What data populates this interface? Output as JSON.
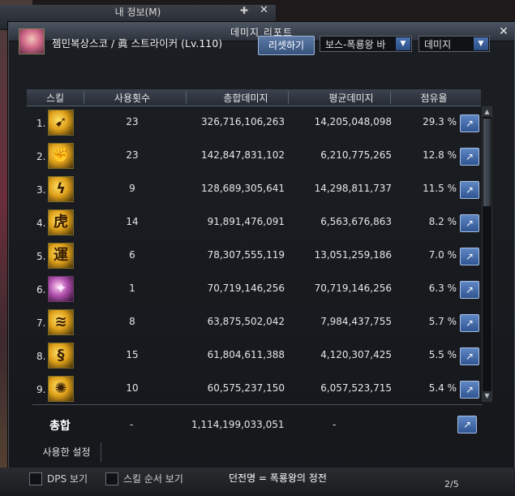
{
  "back_window": {
    "title": "내 정보(M)",
    "pin_icon": "pin-icon",
    "close_icon": "close-icon"
  },
  "window": {
    "title": "데미지 리포트",
    "close_icon": "close-icon"
  },
  "toolbar": {
    "character": "젬민복상스코 / 眞 스트라이커 (Lv.110)",
    "reset_label": "리셋하기",
    "target_select": "보스-폭룡왕 바",
    "metric_select": "데미지"
  },
  "table": {
    "headers": [
      "스킬",
      "사용횟수",
      "총합데미지",
      "평균데미지",
      "점유율"
    ],
    "rows": [
      {
        "num": "1.",
        "icon": "dash-strike-icon",
        "uses": "23",
        "total": "326,716,106,263",
        "avg": "14,205,048,098",
        "share": "29.3 %"
      },
      {
        "num": "2.",
        "icon": "tiger-fist-icon",
        "uses": "23",
        "total": "142,847,831,102",
        "avg": "6,210,775,265",
        "share": "12.8 %"
      },
      {
        "num": "3.",
        "icon": "lightning-kick-icon",
        "uses": "9",
        "total": "128,689,305,641",
        "avg": "14,298,811,737",
        "share": "11.5 %"
      },
      {
        "num": "4.",
        "icon": "tiger-character-icon",
        "uses": "14",
        "total": "91,891,476,091",
        "avg": "6,563,676,863",
        "share": "8.2 %"
      },
      {
        "num": "5.",
        "icon": "luck-character-icon",
        "uses": "6",
        "total": "78,307,555,119",
        "avg": "13,051,259,186",
        "share": "7.0 %"
      },
      {
        "num": "6.",
        "icon": "spirit-burst-icon",
        "uses": "1",
        "total": "70,719,146,256",
        "avg": "70,719,146,256",
        "share": "6.3 %"
      },
      {
        "num": "7.",
        "icon": "wind-slash-icon",
        "uses": "8",
        "total": "63,875,502,042",
        "avg": "7,984,437,755",
        "share": "5.7 %"
      },
      {
        "num": "8.",
        "icon": "dragon-coil-icon",
        "uses": "15",
        "total": "61,804,611,388",
        "avg": "4,120,307,425",
        "share": "5.5 %"
      },
      {
        "num": "9.",
        "icon": "radiant-burst-icon",
        "uses": "10",
        "total": "60,575,237,150",
        "avg": "6,057,523,715",
        "share": "5.4 %"
      }
    ],
    "share_icon": "share-icon"
  },
  "total": {
    "label": "총합",
    "uses": "-",
    "total": "1,114,199,033,051",
    "avg": "-"
  },
  "settings_tab": "사용한 설정",
  "bottom": {
    "dps_label": "DPS 보기",
    "skill_order_label": "스킬 순서 보기",
    "dungeon": "던전명 = 폭룡왕의 정전",
    "page": "2/5"
  },
  "colors": {
    "accent_blue": "#36537d",
    "window_bg": "#15171b",
    "skill_icon_gold": "#e0a11a"
  }
}
